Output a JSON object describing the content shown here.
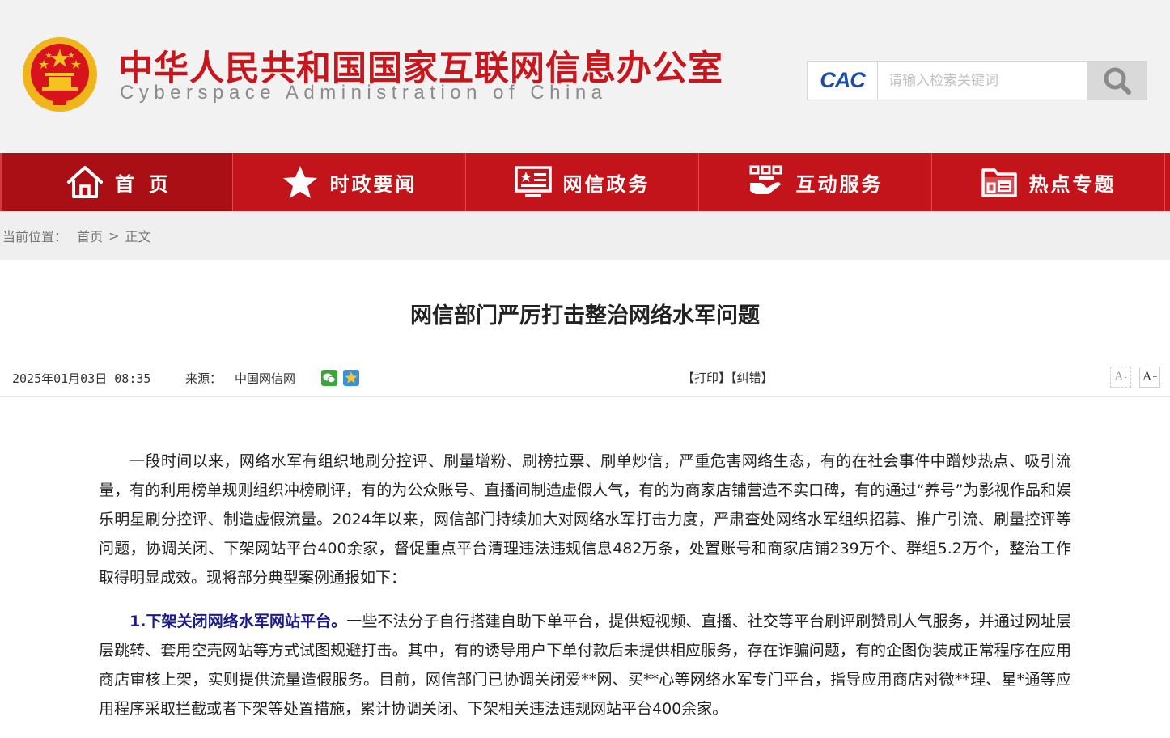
{
  "header": {
    "title_cn": "中华人民共和国国家互联网信息办公室",
    "title_en": "Cyberspace Administration of China",
    "search": {
      "logo_text": "CAC",
      "placeholder": "请输入检索关键词"
    }
  },
  "nav": {
    "items": [
      {
        "label": "首页",
        "icon": "home-icon"
      },
      {
        "label": "时政要闻",
        "icon": "star-icon"
      },
      {
        "label": "网信政务",
        "icon": "monitor-icon"
      },
      {
        "label": "互动服务",
        "icon": "handshake-icon"
      },
      {
        "label": "热点专题",
        "icon": "folder-icon"
      }
    ]
  },
  "breadcrumb": {
    "prefix": "当前位置：",
    "home": "首页",
    "separator": ">",
    "current": "正文"
  },
  "article": {
    "title": "网信部门严厉打击整治网络水军问题",
    "datetime": "2025年01月03日 08:35",
    "source_label": "来源：",
    "source": "中国网信网",
    "share_icons": [
      "wechat-icon",
      "qzone-icon"
    ],
    "print": "【打印】",
    "error": "【纠错】",
    "font_smaller": "A",
    "font_larger": "A",
    "paragraphs": [
      {
        "lead": "",
        "text": "一段时间以来，网络水军有组织地刷分控评、刷量增粉、刷榜拉票、刷单炒信，严重危害网络生态，有的在社会事件中蹭炒热点、吸引流量，有的利用榜单规则组织冲榜刷评，有的为公众账号、直播间制造虚假人气，有的为商家店铺营造不实口碑，有的通过“养号”为影视作品和娱乐明星刷分控评、制造虚假流量。2024年以来，网信部门持续加大对网络水军打击力度，严肃查处网络水军组织招募、推广引流、刷量控评等问题，协调关闭、下架网站平台400余家，督促重点平台清理违法违规信息482万条，处置账号和商家店铺239万个、群组5.2万个，整治工作取得明显成效。现将部分典型案例通报如下："
      },
      {
        "lead": "1.下架关闭网络水军网站平台。",
        "text": "一些不法分子自行搭建自助下单平台，提供短视频、直播、社交等平台刷评刷赞刷人气服务，并通过网址层层跳转、套用空壳网站等方式试图规避打击。其中，有的诱导用户下单付款后未提供相应服务，存在诈骗问题，有的企图伪装成正常程序在应用商店审核上架，实则提供流量造假服务。目前，网信部门已协调关闭爱**网、买**心等网络水军专门平台，指导应用商店对微**理、星*通等应用程序采取拦截或者下架等处置措施，累计协调关闭、下架相关违法违规网站平台400余家。"
      }
    ]
  },
  "colors": {
    "brand_red": "#c3141b",
    "title_red": "#c8161d",
    "lead_blue": "#1a1a8c"
  }
}
